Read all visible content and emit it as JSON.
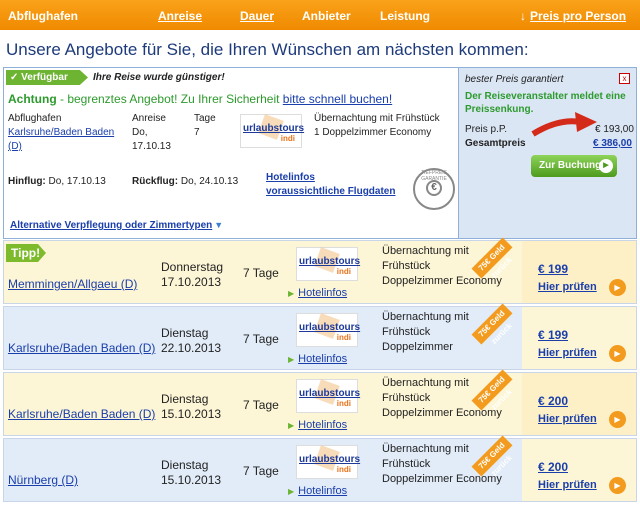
{
  "header": {
    "abflughafen": "Abflughafen",
    "anreise": "Anreise",
    "dauer": "Dauer",
    "anbieter": "Anbieter",
    "leistung": "Leistung",
    "preis_sort_arrow": "↓",
    "preis": "Preis pro Person"
  },
  "headline": "Unsere Angebote für Sie, die Ihren Wünschen am nächsten kommen:",
  "featured": {
    "badge": "✓ Verfügbar",
    "badge_sub": "Ihre Reise wurde günstiger!",
    "warn_bold": "Achtung",
    "warn_text": " - begrenztes Angebot! Zu Ihrer Sicherheit ",
    "warn_link": "bitte schnell buchen!",
    "col_airport": "Abflughafen",
    "airport_line1": "Karlsruhe/Baden Baden",
    "airport_line2": "(D)",
    "col_arrival": "Anreise",
    "arrival_line1": "Do,",
    "arrival_line2": "17.10.13",
    "col_days": "Tage",
    "days": "7",
    "provider_logo": "urlaubstours",
    "provider_logo_sub": "indi",
    "board_line1": "Übernachtung mit Frühstück",
    "board_line2": "1 Doppelzimmer Economy",
    "hinflug_label": "Hinflug:",
    "hinflug_value": " Do, 17.10.13",
    "rueckflug_label": "Rückflug:",
    "rueckflug_value": " Do, 24.10.13",
    "hotelinfos": "Hotelinfos",
    "flugdaten": "voraussichtliche Flugdaten",
    "seal_text": "TIEFPREIS GARANTIE",
    "seal_symbol": "€",
    "alternative": "Alternative Verpflegung oder Zimmertypen",
    "alternative_chevron": "▼"
  },
  "price_box": {
    "title": "bester Preis garantiert",
    "close": "x",
    "notice": "Der Reiseveranstalter meldet eine Preissenkung.",
    "pp_label": "Preis p.P.",
    "pp_value": "€ 193,00",
    "total_label": "Gesamtpreis",
    "total_value": "€ 386,00",
    "book_button": "Zur Buchung",
    "book_button_icon": "▶"
  },
  "offers": [
    {
      "tipp": "Tipp!",
      "airport": "Memmingen/Allgaeu (D)",
      "weekday": "Donnerstag",
      "date": "17.10.2013",
      "days": "7 Tage",
      "hotel_link": "Hotelinfos",
      "board": "Übernachtung mit Frühstück",
      "room": "Doppelzimmer Economy",
      "ribbon": "75€ Geld zurück",
      "price": "€ 199",
      "check": "Hier prüfen"
    },
    {
      "tipp": "",
      "airport": "Karlsruhe/Baden Baden (D)",
      "weekday": "Dienstag",
      "date": "22.10.2013",
      "days": "7 Tage",
      "hotel_link": "Hotelinfos",
      "board": "Übernachtung mit Frühstück",
      "room": "Doppelzimmer",
      "ribbon": "75€ Geld zurück",
      "price": "€ 199",
      "check": "Hier prüfen"
    },
    {
      "tipp": "",
      "airport": "Karlsruhe/Baden Baden (D)",
      "weekday": "Dienstag",
      "date": "15.10.2013",
      "days": "7 Tage",
      "hotel_link": "Hotelinfos",
      "board": "Übernachtung mit Frühstück",
      "room": "Doppelzimmer Economy",
      "ribbon": "75€ Geld zurück",
      "price": "€ 200",
      "check": "Hier prüfen"
    },
    {
      "tipp": "",
      "airport": "Nürnberg (D)",
      "weekday": "Dienstag",
      "date": "15.10.2013",
      "days": "7 Tage",
      "hotel_link": "Hotelinfos",
      "board": "Übernachtung mit Frühstück",
      "room": "Doppelzimmer Economy",
      "ribbon": "75€ Geld zurück",
      "price": "€ 200",
      "check": "Hier prüfen"
    }
  ],
  "icons": {
    "play": "▶",
    "tri": "▶"
  },
  "colors": {
    "header_orange": "#f39b1e",
    "link_blue": "#1a3eaa",
    "green": "#2d9a2d"
  }
}
